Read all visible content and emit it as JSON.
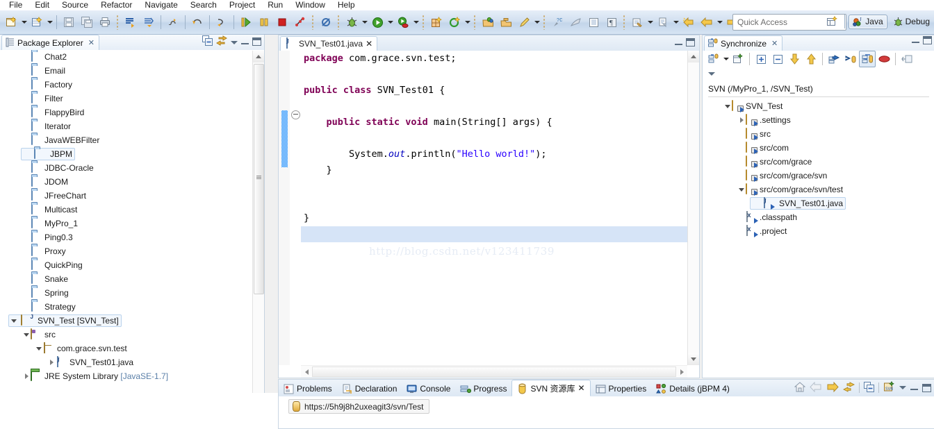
{
  "menu": {
    "items": [
      "File",
      "Edit",
      "Source",
      "Refactor",
      "Navigate",
      "Search",
      "Project",
      "Run",
      "Window",
      "Help"
    ]
  },
  "toolbar": {
    "groups": [
      {
        "icons": [
          "new-wizard-icon",
          "dropdown-arrow",
          "new-java-class-icon",
          "dropdown-arrow"
        ]
      },
      {
        "icons": [
          "save-icon",
          "save-all-icon",
          "print-icon"
        ]
      },
      {
        "icons": [
          "next-annotation-icon",
          "previous-annotation-icon"
        ]
      },
      {
        "icons": [
          "last-edit-location-icon"
        ]
      },
      {
        "icons": [
          "back-icon"
        ]
      },
      {
        "icons": [
          "forward-edit-icon"
        ]
      },
      {
        "icons": [
          "run-debug-step-icon",
          "pause-icon",
          "terminate-icon",
          "disconnect-icon"
        ]
      },
      {
        "icons": [
          "skip-breakpoints-icon"
        ]
      },
      {
        "icons": [
          "debug-icon",
          "dropdown-arrow",
          "run-icon",
          "dropdown-arrow",
          "run-external-tools-icon",
          "dropdown-arrow"
        ]
      },
      {
        "icons": [
          "new-java-project-icon",
          "new-package-icon",
          "dropdown-arrow"
        ]
      },
      {
        "icons": [
          "open-type-icon",
          "open-task-icon",
          "edit-icon",
          "dropdown-arrow"
        ]
      },
      {
        "icons": [
          "toggle-mark-occurrences-icon",
          "link-icon",
          "show-whitespace-icon",
          "pilcrow-icon"
        ]
      },
      {
        "icons": [
          "search-icon",
          "dropdown-arrow",
          "open-resource-icon",
          "dropdown-arrow",
          "back-history-icon",
          "back-arrow-icon",
          "dropdown-arrow",
          "forward-arrow-icon",
          "dropdown-arrow"
        ]
      },
      {
        "icons": [
          "new-window-icon"
        ]
      }
    ],
    "quick_access_placeholder": "Quick Access",
    "perspectives": [
      {
        "label": "Java",
        "icon": "java-perspective-icon",
        "active": true
      },
      {
        "label": "Debug",
        "icon": "debug-perspective-icon",
        "active": false
      }
    ],
    "open_perspective_icon": "open-perspective-icon"
  },
  "package_explorer": {
    "title": "Package Explorer",
    "close_glyph": "✕",
    "tools": [
      "collapse-all-icon",
      "link-with-editor-icon",
      "view-menu-icon",
      "minimize-icon",
      "maximize-icon"
    ],
    "tree": [
      {
        "label": "Chat2",
        "icon": "folder-icon",
        "indent": 1,
        "arrow": "none",
        "selected": false
      },
      {
        "label": "Email",
        "icon": "folder-icon",
        "indent": 1,
        "arrow": "none",
        "selected": false
      },
      {
        "label": "Factory",
        "icon": "folder-icon",
        "indent": 1,
        "arrow": "none",
        "selected": false
      },
      {
        "label": "Filter",
        "icon": "folder-icon",
        "indent": 1,
        "arrow": "none",
        "selected": false
      },
      {
        "label": "FlappyBird",
        "icon": "folder-icon",
        "indent": 1,
        "arrow": "none",
        "selected": false
      },
      {
        "label": "Iterator",
        "icon": "folder-icon",
        "indent": 1,
        "arrow": "none",
        "selected": false
      },
      {
        "label": "JavaWEBFilter",
        "icon": "folder-icon",
        "indent": 1,
        "arrow": "none",
        "selected": false
      },
      {
        "label": "JBPM",
        "icon": "folder-icon",
        "indent": 1,
        "arrow": "none",
        "selected": true
      },
      {
        "label": "JDBC-Oracle",
        "icon": "folder-icon",
        "indent": 1,
        "arrow": "none",
        "selected": false
      },
      {
        "label": "JDOM",
        "icon": "folder-icon",
        "indent": 1,
        "arrow": "none",
        "selected": false
      },
      {
        "label": "JFreeChart",
        "icon": "folder-icon",
        "indent": 1,
        "arrow": "none",
        "selected": false
      },
      {
        "label": "Multicast",
        "icon": "folder-icon",
        "indent": 1,
        "arrow": "none",
        "selected": false
      },
      {
        "label": "MyPro_1",
        "icon": "folder-icon",
        "indent": 1,
        "arrow": "none",
        "selected": false
      },
      {
        "label": "Ping0.3",
        "icon": "folder-icon",
        "indent": 1,
        "arrow": "none",
        "selected": false
      },
      {
        "label": "Proxy",
        "icon": "folder-icon",
        "indent": 1,
        "arrow": "none",
        "selected": false
      },
      {
        "label": "QuickPing",
        "icon": "folder-icon",
        "indent": 1,
        "arrow": "none",
        "selected": false
      },
      {
        "label": "Snake",
        "icon": "folder-icon",
        "indent": 1,
        "arrow": "none",
        "selected": false
      },
      {
        "label": "Spring",
        "icon": "folder-icon",
        "indent": 1,
        "arrow": "none",
        "selected": false
      },
      {
        "label": "Strategy",
        "icon": "folder-icon",
        "indent": 1,
        "arrow": "none",
        "selected": false
      },
      {
        "label": "SVN_Test [SVN_Test]",
        "icon": "java-project-icon",
        "indent": 0,
        "arrow": "open",
        "selected": true
      },
      {
        "label": "src",
        "icon": "source-folder-icon",
        "indent": 1,
        "arrow": "open",
        "selected": false
      },
      {
        "label": "com.grace.svn.test",
        "icon": "package-icon",
        "indent": 2,
        "arrow": "open",
        "selected": false
      },
      {
        "label": "SVN_Test01.java",
        "icon": "java-file-icon",
        "indent": 3,
        "arrow": "closed",
        "selected": false
      },
      {
        "label": "JRE System Library ",
        "suffix": "[JavaSE-1.7]",
        "icon": "jre-library-icon",
        "indent": 1,
        "arrow": "closed",
        "selected": false
      }
    ]
  },
  "editor": {
    "tab": {
      "label": "SVN_Test01.java",
      "icon": "java-file-icon",
      "close_glyph": "✕"
    },
    "tools": [
      "minimize-icon",
      "maximize-icon"
    ],
    "watermark": "http://blog.csdn.net/v123411739",
    "code_lines": [
      {
        "parts": [
          {
            "t": "package ",
            "c": "kw"
          },
          {
            "t": "com.grace.svn.test;",
            "c": ""
          }
        ],
        "indent": 0
      },
      {
        "parts": [],
        "indent": 0
      },
      {
        "parts": [
          {
            "t": "public class ",
            "c": "kw"
          },
          {
            "t": "SVN_Test01 {",
            "c": ""
          }
        ],
        "indent": 0
      },
      {
        "parts": [],
        "indent": 0
      },
      {
        "parts": [
          {
            "t": "public static void ",
            "c": "kw"
          },
          {
            "t": "main(String[] args) {",
            "c": ""
          }
        ],
        "indent": 1,
        "fold": true
      },
      {
        "parts": [],
        "indent": 0
      },
      {
        "parts": [
          {
            "t": "System.",
            "c": ""
          },
          {
            "t": "out",
            "c": "fld"
          },
          {
            "t": ".println(",
            "c": ""
          },
          {
            "t": "\"Hello world!\"",
            "c": "str"
          },
          {
            "t": ");",
            "c": ""
          }
        ],
        "indent": 2
      },
      {
        "parts": [
          {
            "t": "}",
            "c": ""
          }
        ],
        "indent": 1
      },
      {
        "parts": [],
        "indent": 0
      },
      {
        "parts": [],
        "indent": 0
      },
      {
        "parts": [
          {
            "t": "}",
            "c": ""
          }
        ],
        "indent": 0
      },
      {
        "parts": [],
        "indent": 0,
        "highlight": true
      }
    ]
  },
  "synchronize": {
    "title": "Synchronize",
    "close_glyph": "✕",
    "tools": [
      "synchronize-icon",
      "dropdown-arrow",
      "new-synchronization-icon",
      "expand-all-icon",
      "collapse-all-icon",
      "next-change-icon",
      "previous-change-icon",
      "update-icon",
      "commit-icon",
      "both-mode-icon",
      "conflicts-icon",
      "pin-icon"
    ],
    "view_menu_icon": "view-menu-icon",
    "header_tools": [
      "minimize-icon",
      "maximize-icon"
    ],
    "scope": "SVN (/MyPro_1, /SVN_Test)",
    "tree": [
      {
        "label": "SVN_Test",
        "icon": "sync-folder-icon",
        "indent": 0,
        "arrow": "open",
        "selected": false
      },
      {
        "label": ".settings",
        "icon": "sync-folder-icon",
        "indent": 1,
        "arrow": "closed",
        "selected": false
      },
      {
        "label": "src",
        "icon": "sync-folder-icon",
        "indent": 1,
        "arrow": "none",
        "selected": false
      },
      {
        "label": "src/com",
        "icon": "sync-folder-icon",
        "indent": 1,
        "arrow": "none",
        "selected": false
      },
      {
        "label": "src/com/grace",
        "icon": "sync-folder-icon",
        "indent": 1,
        "arrow": "none",
        "selected": false
      },
      {
        "label": "src/com/grace/svn",
        "icon": "sync-folder-icon",
        "indent": 1,
        "arrow": "none",
        "selected": false
      },
      {
        "label": "src/com/grace/svn/test",
        "icon": "sync-folder-icon",
        "indent": 1,
        "arrow": "open",
        "selected": false
      },
      {
        "label": "SVN_Test01.java",
        "icon": "java-file-outgoing-icon",
        "indent": 2,
        "arrow": "none",
        "selected": true
      },
      {
        "label": ".classpath",
        "icon": "xml-file-outgoing-icon",
        "indent": 1,
        "arrow": "none",
        "selected": false
      },
      {
        "label": ".project",
        "icon": "xml-file-outgoing-icon",
        "indent": 1,
        "arrow": "none",
        "selected": false
      }
    ]
  },
  "bottom_panel": {
    "tabs": [
      {
        "label": "Problems",
        "icon": "problems-icon",
        "active": false
      },
      {
        "label": "Declaration",
        "icon": "declaration-icon",
        "active": false
      },
      {
        "label": "Console",
        "icon": "console-icon",
        "active": false
      },
      {
        "label": "Progress",
        "icon": "progress-icon",
        "active": false
      },
      {
        "label": "SVN 资源库",
        "icon": "svn-repository-icon",
        "active": true,
        "close_glyph": "✕"
      },
      {
        "label": "Properties",
        "icon": "properties-icon",
        "active": false
      },
      {
        "label": "Details (jBPM 4)",
        "icon": "details-icon",
        "active": false
      }
    ],
    "tools": [
      "home-icon",
      "back-arrow-icon",
      "forward-arrow-icon",
      "refresh-icon",
      "collapse-all-icon",
      "new-repository-location-icon",
      "view-menu-icon",
      "minimize-icon",
      "maximize-icon"
    ],
    "repository_url": "https://5h9j8h2uxeagit3/svn/Test"
  },
  "colors": {
    "keyword": "#7f0055",
    "string": "#2a00ff",
    "field": "#0000c0",
    "selection": "#d6e4f7",
    "toolbar_bg": "#d2e0f0",
    "watermark": "#e6ecf5"
  }
}
